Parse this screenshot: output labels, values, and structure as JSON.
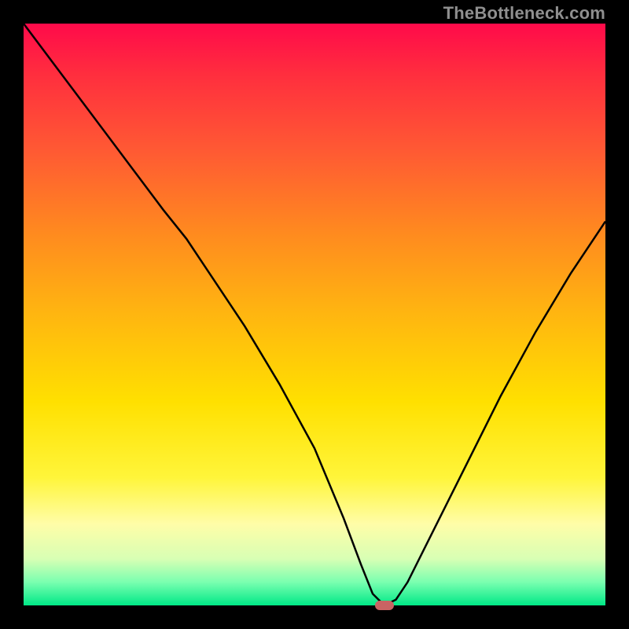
{
  "watermark": "TheBottleneck.com",
  "chart_data": {
    "type": "line",
    "title": "",
    "xlabel": "",
    "ylabel": "",
    "xlim": [
      0,
      100
    ],
    "ylim": [
      0,
      100
    ],
    "x": [
      0,
      6,
      12,
      18,
      24,
      28,
      32,
      38,
      44,
      50,
      55,
      58,
      60,
      62,
      64,
      66,
      70,
      76,
      82,
      88,
      94,
      100
    ],
    "values": [
      100,
      92,
      84,
      76,
      68,
      63,
      57,
      48,
      38,
      27,
      15,
      7,
      2,
      0,
      1,
      4,
      12,
      24,
      36,
      47,
      57,
      66
    ],
    "optimum": {
      "x": 62,
      "y": 0
    },
    "background": "red-yellow-green vertical gradient"
  },
  "colors": {
    "curve": "#000000",
    "optimum_pill": "#c96363"
  }
}
